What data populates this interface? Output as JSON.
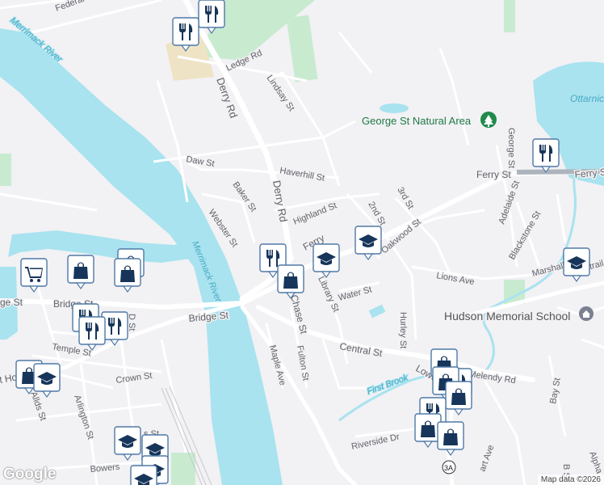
{
  "streets": {
    "federal": "Federal",
    "ledge": "Ledge Rd",
    "lindsay": "Lindsay St",
    "derry_n": "Derry Rd",
    "derry_s": "Derry Rd",
    "daw": "Daw St",
    "haverhill": "Haverhill St",
    "baker": "Baker St",
    "webster": "Webster St",
    "highland": "Highland St",
    "ferry_e": "Ferry St",
    "ferry_e2": "Ferry St",
    "ferry_w": "Ferry",
    "second": "2nd St",
    "third": "3rd St",
    "oakwood": "Oakwood St",
    "library": "Library St",
    "water": "Water St",
    "lions": "Lions Ave",
    "hurley": "Hurley St",
    "marshall": "Marshall",
    "blackstone": "Blackstone St",
    "adelaide": "Adelaide St",
    "george": "George St",
    "chase": "Chase St",
    "bridge_w": "Bridge St",
    "bridge_w2": "ge St",
    "bridge_e": "Bridge St",
    "temple": "Temple St",
    "crown": "Crown St",
    "hollis": "t Hollis St",
    "allds": "Allds St",
    "arlington": "Arlington St",
    "bowers": "Bowers",
    "maple": "Maple Ave",
    "fulton": "Fulton St",
    "central": "Central St",
    "lowell": "Lowe",
    "melendy": "Melendy Rd",
    "riverside": "Riverside Dr",
    "bay": "Bay St",
    "ave_s": "art Ave",
    "alpha": "Alpha",
    "b_st": "B St",
    "d_st": "D St",
    "s_st": "s St",
    "route": "3A",
    "trail": "ttrail"
  },
  "places": {
    "river1": "Merrimack River",
    "river2": "Merrimack River",
    "brook": "First Brook",
    "park": "George St Natural Area",
    "school": "Hudson Memorial School",
    "pond": "Ottarnic"
  },
  "map_labels": {
    "logo": "Google",
    "attribution": "Map data ©2026"
  },
  "icons": [
    "fork-knife-icon",
    "shopping-bag-icon",
    "shopping-cart-icon",
    "graduation-cap-icon",
    "tree-icon",
    "school-icon"
  ]
}
